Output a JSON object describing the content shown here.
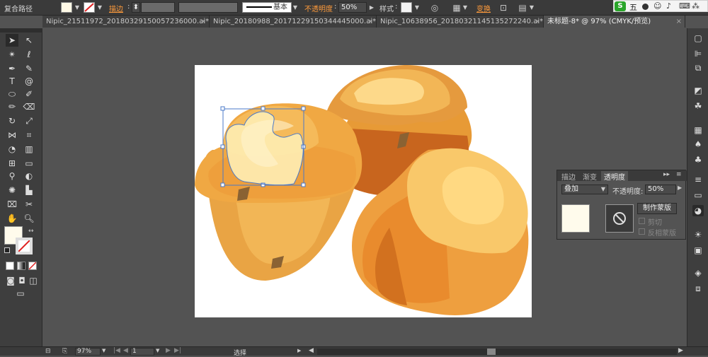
{
  "control_bar": {
    "path_type": "复合路径",
    "stroke_label": "描边",
    "style_preset": "基本",
    "opacity_label": "不透明度",
    "opacity_value": "50%",
    "style_label": "样式",
    "transform_label": "变换"
  },
  "tabs": [
    {
      "label": "Nipic_21511972_20180329150057236000.ai*"
    },
    {
      "label": "Nipic_20180988_20171229150344445000.ai*"
    },
    {
      "label": "Nipic_10638956_20180321145135272240.ai*"
    },
    {
      "label": "未标题-8* @ 97% (CMYK/预览)"
    }
  ],
  "transparency_panel": {
    "tab_stroke": "描边",
    "tab_gradient": "渐变",
    "tab_transparency": "透明度",
    "blend_mode": "叠加",
    "opacity_label": "不透明度:",
    "opacity_value": "50%",
    "make_mask_button": "制作蒙版",
    "clip_label": "剪切",
    "invert_mask_label": "反相蒙版"
  },
  "status_bar": {
    "zoom": "97%",
    "page": "1",
    "tool_status": "选择"
  },
  "ime": {
    "label": "五"
  },
  "icons": {
    "selection": "selection-arrow-icon",
    "direct_selection": "direct-selection-icon",
    "prohibit": "prohibit-icon"
  }
}
